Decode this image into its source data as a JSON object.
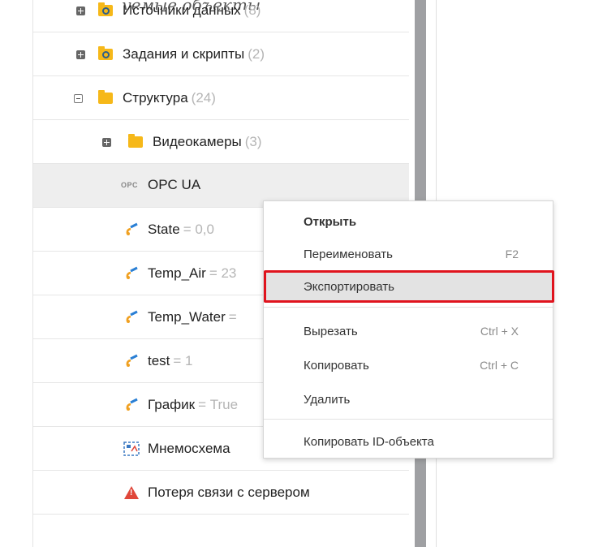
{
  "caption": "уемые объекты",
  "tree": {
    "rows": [
      {
        "label": "Источники данных",
        "count": "(8)"
      },
      {
        "label": "Задания и скрипты",
        "count": "(2)"
      },
      {
        "label": "Структура",
        "count": "(24)"
      },
      {
        "label": "Видеокамеры",
        "count": "(3)"
      },
      {
        "label": "OPC UA",
        "icon_text": "OPC"
      },
      {
        "label": "State",
        "value": "= 0,0"
      },
      {
        "label": "Temp_Air",
        "value": "= 23"
      },
      {
        "label": "Temp_Water",
        "value": "="
      },
      {
        "label": "test",
        "value": "= 1"
      },
      {
        "label": "График",
        "value": "= True"
      },
      {
        "label": "Мнемосхема"
      },
      {
        "label": "Потеря связи с сервером"
      }
    ]
  },
  "context_menu": {
    "open": "Открыть",
    "rename": "Переименовать",
    "rename_shortcut": "F2",
    "export": "Экспортировать",
    "cut": "Вырезать",
    "cut_shortcut": "Ctrl + X",
    "copy": "Копировать",
    "copy_shortcut": "Ctrl + C",
    "delete": "Удалить",
    "copy_id": "Копировать ID-объекта"
  },
  "colors": {
    "folder": "#f6b819",
    "highlight_border": "#e0141e",
    "selected_row": "#eeeeee",
    "scrollbar": "#9fa0a3"
  }
}
